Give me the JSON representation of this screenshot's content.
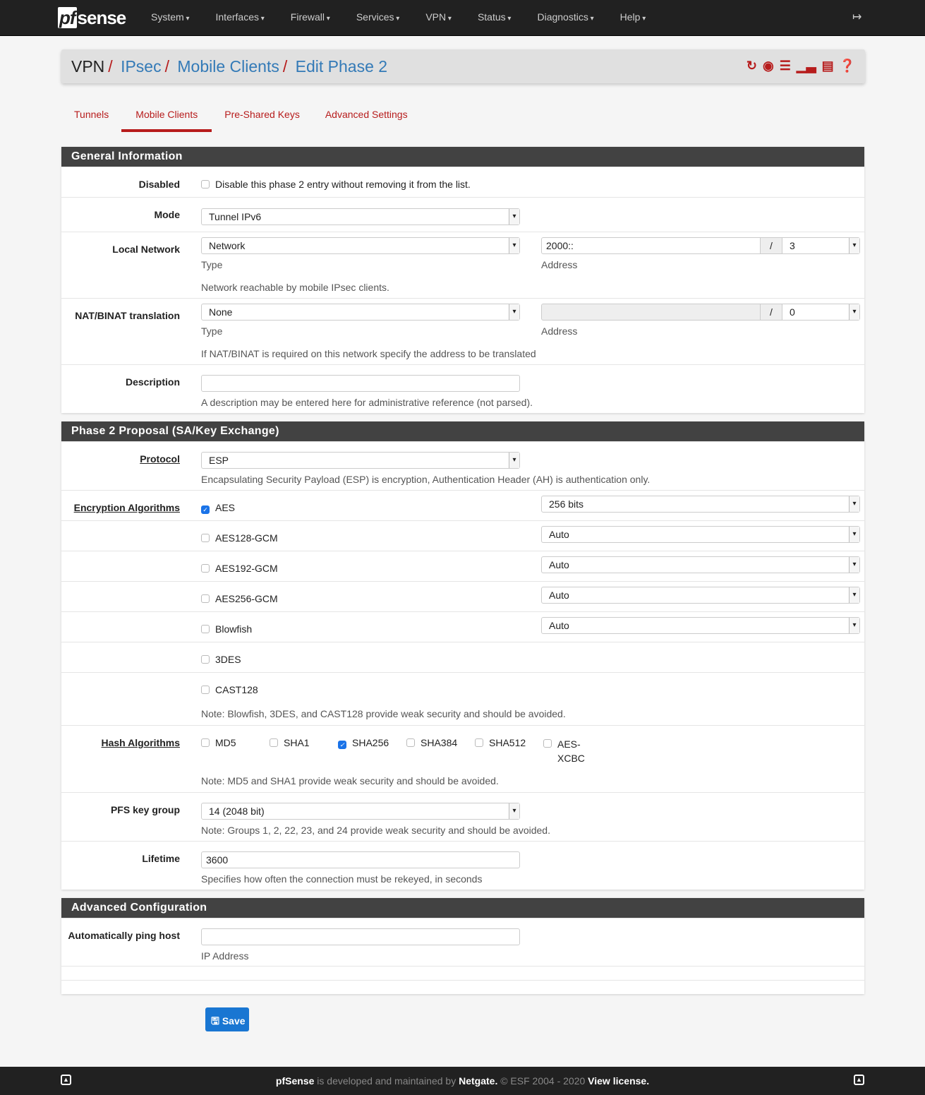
{
  "nav": {
    "logo": "pfsense",
    "items": [
      "System",
      "Interfaces",
      "Firewall",
      "Services",
      "VPN",
      "Status",
      "Diagnostics",
      "Help"
    ],
    "logout_icon": "sign-out-icon"
  },
  "breadcrumb": {
    "root": "VPN",
    "items": [
      "IPsec",
      "Mobile Clients",
      "Edit Phase 2"
    ],
    "icons": [
      "restart-icon",
      "stop-icon",
      "settings-icon",
      "status-chart-icon",
      "logs-icon",
      "help-icon"
    ]
  },
  "tabs": [
    {
      "label": "Tunnels"
    },
    {
      "label": "Mobile Clients",
      "active": true
    },
    {
      "label": "Pre-Shared Keys"
    },
    {
      "label": "Advanced Settings"
    }
  ],
  "general": {
    "title": "General Information",
    "disabled": {
      "label": "Disabled",
      "text": "Disable this phase 2 entry without removing it from the list.",
      "checked": false
    },
    "mode": {
      "label": "Mode",
      "value": "Tunnel IPv6"
    },
    "local": {
      "label": "Local Network",
      "type": "Network",
      "type_label": "Type",
      "address": "2000::",
      "slash": "/",
      "mask": "3",
      "address_label": "Address",
      "help": "Network reachable by mobile IPsec clients."
    },
    "nat": {
      "label": "NAT/BINAT translation",
      "type": "None",
      "type_label": "Type",
      "address": "",
      "slash": "/",
      "mask": "0",
      "address_label": "Address",
      "help": "If NAT/BINAT is required on this network specify the address to be translated"
    },
    "description": {
      "label": "Description",
      "value": "",
      "help": "A description may be entered here for administrative reference (not parsed)."
    }
  },
  "phase2": {
    "title": "Phase 2 Proposal (SA/Key Exchange)",
    "protocol": {
      "label": "Protocol",
      "value": "ESP",
      "help": "Encapsulating Security Payload (ESP) is encryption, Authentication Header (AH) is authentication only."
    },
    "enc_label": "Encryption Algorithms",
    "enc": [
      {
        "name": "AES",
        "checked": true,
        "keylen": "256 bits"
      },
      {
        "name": "AES128-GCM",
        "checked": false,
        "keylen": "Auto"
      },
      {
        "name": "AES192-GCM",
        "checked": false,
        "keylen": "Auto"
      },
      {
        "name": "AES256-GCM",
        "checked": false,
        "keylen": "Auto"
      },
      {
        "name": "Blowfish",
        "checked": false,
        "keylen": "Auto"
      },
      {
        "name": "3DES",
        "checked": false
      },
      {
        "name": "CAST128",
        "checked": false
      }
    ],
    "enc_note": "Note: Blowfish, 3DES, and CAST128 provide weak security and should be avoided.",
    "hash_label": "Hash Algorithms",
    "hash": [
      {
        "name": "MD5",
        "checked": false
      },
      {
        "name": "SHA1",
        "checked": false
      },
      {
        "name": "SHA256",
        "checked": true
      },
      {
        "name": "SHA384",
        "checked": false
      },
      {
        "name": "SHA512",
        "checked": false
      },
      {
        "name": "AES-XCBC",
        "checked": false
      }
    ],
    "hash_note": "Note: MD5 and SHA1 provide weak security and should be avoided.",
    "pfs": {
      "label": "PFS key group",
      "value": "14 (2048 bit)",
      "help": "Note: Groups 1, 2, 22, 23, and 24 provide weak security and should be avoided."
    },
    "lifetime": {
      "label": "Lifetime",
      "value": "3600",
      "help": "Specifies how often the connection must be rekeyed, in seconds"
    }
  },
  "advanced": {
    "title": "Advanced Configuration",
    "ping": {
      "label": "Automatically ping host",
      "value": "",
      "help": "IP Address"
    }
  },
  "save_label": "Save",
  "footer": {
    "brand": "pfSense",
    "mid": " is developed and maintained by ",
    "company": "Netgate.",
    "copy": " © ESF 2004 - 2020 ",
    "license": "View license."
  },
  "colors": {
    "accent": "#b71c1c",
    "link": "#337ab7",
    "nav": "#212121",
    "save": "#1976d2",
    "panel_header": "#424242"
  }
}
